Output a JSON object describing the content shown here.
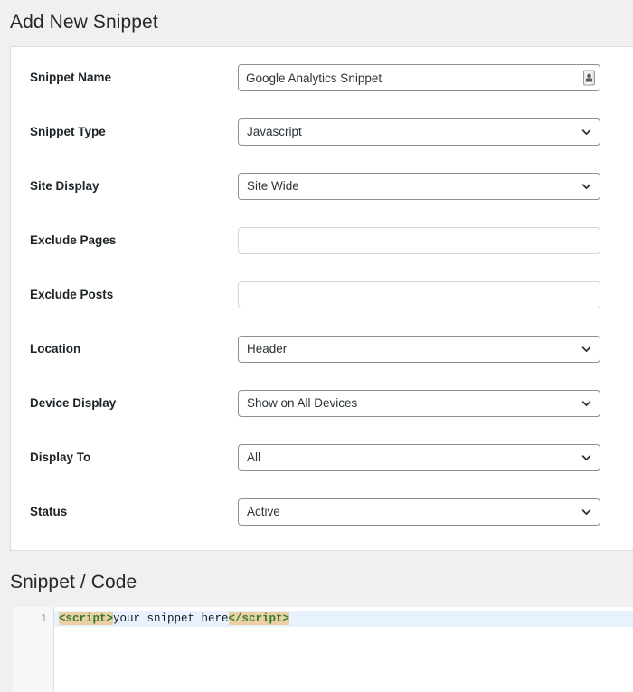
{
  "page": {
    "title": "Add New Snippet",
    "code_section_title": "Snippet / Code"
  },
  "form": {
    "fields": [
      {
        "label": "Snippet Name",
        "type": "text",
        "value": "Google Analytics Snippet",
        "placeholder": "",
        "icon": "autofill-key-icon"
      },
      {
        "label": "Snippet Type",
        "type": "select",
        "value": "Javascript"
      },
      {
        "label": "Site Display",
        "type": "select",
        "value": "Site Wide"
      },
      {
        "label": "Exclude Pages",
        "type": "text",
        "value": "",
        "placeholder": ""
      },
      {
        "label": "Exclude Posts",
        "type": "text",
        "value": "",
        "placeholder": ""
      },
      {
        "label": "Location",
        "type": "select",
        "value": "Header"
      },
      {
        "label": "Device Display",
        "type": "select",
        "value": "Show on All Devices"
      },
      {
        "label": "Display To",
        "type": "select",
        "value": "All"
      },
      {
        "label": "Status",
        "type": "select",
        "value": "Active"
      }
    ]
  },
  "editor": {
    "line_numbers": [
      "1"
    ],
    "code": {
      "open_tag": "<script>",
      "body": "your snippet here",
      "close_tag": "</script>"
    }
  },
  "colors": {
    "page_background": "#f0f0f0",
    "card_background": "#ffffff",
    "card_border": "#dcdcde",
    "label_text": "#1d2327",
    "input_border": "#8c8f94",
    "input_border_empty": "#d3d6d9",
    "input_text": "#2c3338",
    "active_line": "#e8f2fe",
    "tag_highlight_background": "#eccfa3",
    "tag_text": "#2f7d32",
    "gutter_background": "#f7f7f7",
    "gutter_text": "#999999"
  }
}
